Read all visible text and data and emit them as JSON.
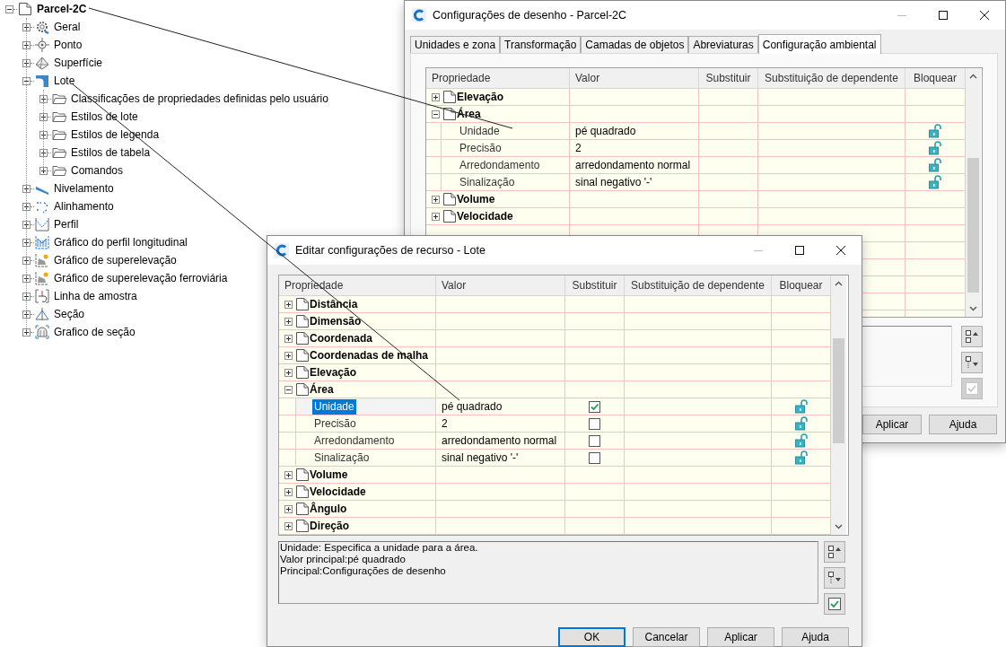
{
  "tree": {
    "label": "Parcel-2C",
    "expanded": true,
    "children": [
      {
        "label": "Geral",
        "expanded": false
      },
      {
        "label": "Ponto",
        "expanded": false
      },
      {
        "label": "Superfície",
        "expanded": false
      },
      {
        "label": "Lote",
        "expanded": true,
        "children": [
          {
            "label": "Classificações de propriedades definidas pelo usuário",
            "expanded": false
          },
          {
            "label": "Estilos de lote",
            "expanded": false
          },
          {
            "label": "Estilos de legenda",
            "expanded": false
          },
          {
            "label": "Estilos de tabela",
            "expanded": false
          },
          {
            "label": "Comandos",
            "expanded": false
          }
        ]
      },
      {
        "label": "Nivelamento",
        "expanded": false
      },
      {
        "label": "Alinhamento",
        "expanded": false
      },
      {
        "label": "Perfil",
        "expanded": false
      },
      {
        "label": "Gráfico do perfil longitudinal",
        "expanded": false
      },
      {
        "label": "Gráfico de superelevação",
        "expanded": false
      },
      {
        "label": "Gráfico de superelevação ferroviária",
        "expanded": false
      },
      {
        "label": "Linha de amostra",
        "expanded": false
      },
      {
        "label": "Seção",
        "expanded": false
      },
      {
        "label": "Grafico de seção",
        "expanded": false
      }
    ]
  },
  "drawing_settings_dialog": {
    "title": "Configurações de desenho - Parcel-2C",
    "tabs": [
      {
        "label": "Unidades e zona",
        "selected": false
      },
      {
        "label": "Transformação",
        "selected": false
      },
      {
        "label": "Camadas de objetos",
        "selected": false
      },
      {
        "label": "Abreviaturas",
        "selected": false
      },
      {
        "label": "Configuração ambiental",
        "selected": true
      }
    ],
    "columns": [
      "Propriedade",
      "Valor",
      "Substituir",
      "Substituição de dependente",
      "Bloquear"
    ],
    "rows": [
      {
        "kind": "group",
        "label": "Elevação",
        "expanded": false
      },
      {
        "kind": "group",
        "label": "Área",
        "expanded": true
      },
      {
        "kind": "property",
        "label": "Unidade",
        "value": "pé quadrado",
        "selected": false
      },
      {
        "kind": "property",
        "label": "Precisão",
        "value": "2",
        "selected": false
      },
      {
        "kind": "property",
        "label": "Arredondamento",
        "value": "arredondamento normal",
        "selected": false
      },
      {
        "kind": "property",
        "label": "Sinalização",
        "value": "sinal negativo '-'",
        "selected": false
      },
      {
        "kind": "group",
        "label": "Volume",
        "expanded": false
      },
      {
        "kind": "group",
        "label": "Velocidade",
        "expanded": false
      }
    ],
    "accept_disabled": true,
    "buttons": [
      {
        "label": "Aplicar",
        "default": false
      },
      {
        "label": "Ajuda",
        "default": false
      }
    ]
  },
  "feature_settings_dialog": {
    "title": "Editar configurações de recurso - Lote",
    "columns": [
      "Propriedade",
      "Valor",
      "Substituir",
      "Substituição de dependente",
      "Bloquear"
    ],
    "rows": [
      {
        "kind": "group",
        "label": "Distância",
        "expanded": false
      },
      {
        "kind": "group",
        "label": "Dimensão",
        "expanded": false
      },
      {
        "kind": "group",
        "label": "Coordenada",
        "expanded": false
      },
      {
        "kind": "group",
        "label": "Coordenadas de malha",
        "expanded": false
      },
      {
        "kind": "group",
        "label": "Elevação",
        "expanded": false
      },
      {
        "kind": "group",
        "label": "Área",
        "expanded": true
      },
      {
        "kind": "property",
        "label": "Unidade",
        "value": "pé quadrado",
        "override": true,
        "selected": true
      },
      {
        "kind": "property",
        "label": "Precisão",
        "value": "2",
        "override": false,
        "selected": false
      },
      {
        "kind": "property",
        "label": "Arredondamento",
        "value": "arredondamento normal",
        "override": false,
        "selected": false
      },
      {
        "kind": "property",
        "label": "Sinalização",
        "value": "sinal negativo '-'",
        "override": false,
        "selected": false
      },
      {
        "kind": "group",
        "label": "Volume",
        "expanded": false
      },
      {
        "kind": "group",
        "label": "Velocidade",
        "expanded": false
      },
      {
        "kind": "group",
        "label": "Ângulo",
        "expanded": false
      },
      {
        "kind": "group",
        "label": "Direção",
        "expanded": false
      }
    ],
    "description": [
      "Unidade: Especifica a unidade para a área.",
      "Valor principal:pé quadrado",
      "Principal:Configurações de desenho"
    ],
    "accept_disabled": false,
    "buttons": [
      {
        "label": "OK",
        "default": true
      },
      {
        "label": "Cancelar",
        "default": false
      },
      {
        "label": "Aplicar",
        "default": false
      },
      {
        "label": "Ajuda",
        "default": false
      }
    ]
  }
}
